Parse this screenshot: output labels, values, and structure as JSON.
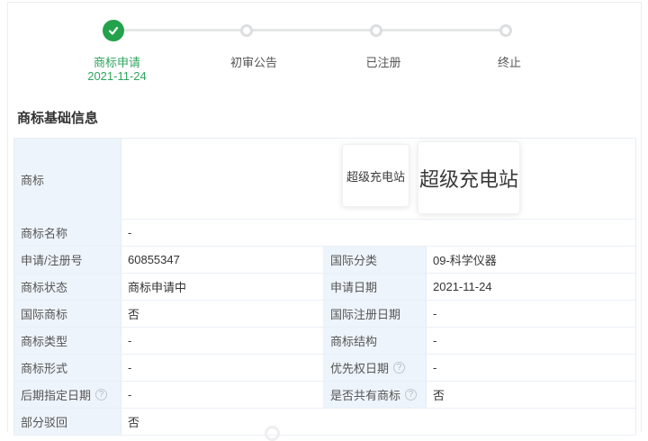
{
  "colors": {
    "accent_green": "#23a24b",
    "accent_text_green": "#2fa45e",
    "label_bg": "#eef4fb"
  },
  "stepper": {
    "steps": [
      {
        "label": "商标申请",
        "date": "2021-11-24",
        "state": "done"
      },
      {
        "label": "初审公告",
        "state": "pending"
      },
      {
        "label": "已注册",
        "state": "pending"
      },
      {
        "label": "终止",
        "state": "pending"
      }
    ]
  },
  "section": {
    "title": "商标基础信息"
  },
  "trademark": {
    "label": "商标",
    "small_image_text": "超级充电站",
    "large_image_text": "超级充电站"
  },
  "table": {
    "help_char": "?",
    "rows": [
      {
        "l1": "商标名称",
        "v1": "-"
      },
      {
        "l1": "申请/注册号",
        "v1": "60855347",
        "l2": "国际分类",
        "v2": "09-科学仪器"
      },
      {
        "l1": "商标状态",
        "v1": "商标申请中",
        "l2": "申请日期",
        "v2": "2021-11-24"
      },
      {
        "l1": "国际商标",
        "v1": "否",
        "l2": "国际注册日期",
        "v2": "-"
      },
      {
        "l1": "商标类型",
        "v1": "-",
        "l2": "商标结构",
        "v2": "-"
      },
      {
        "l1": "商标形式",
        "v1": "-",
        "l2": "优先权日期",
        "v2": "-"
      },
      {
        "l1": "后期指定日期",
        "v1": "-",
        "l2": "是否共有商标",
        "v2": "否"
      },
      {
        "l1": "部分驳回",
        "v1": "否"
      }
    ]
  }
}
